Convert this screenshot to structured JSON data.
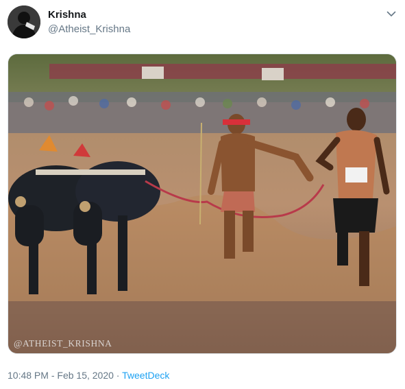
{
  "tweet": {
    "author": {
      "display_name": "Krishna",
      "handle": "@Atheist_Krishna",
      "avatar_icon": "avatar-silhouette"
    },
    "menu_icon": "chevron-down-icon",
    "media": {
      "watermark": "@ATHEIST_KRISHNA"
    },
    "meta": {
      "time": "10:48 PM",
      "separator": " · ",
      "date": "Feb 15, 2020",
      "source": "TweetDeck"
    }
  },
  "colors": {
    "link": "#1da1f2",
    "secondary_text": "#657786",
    "primary_text": "#14171a",
    "border": "#e1e8ed"
  }
}
